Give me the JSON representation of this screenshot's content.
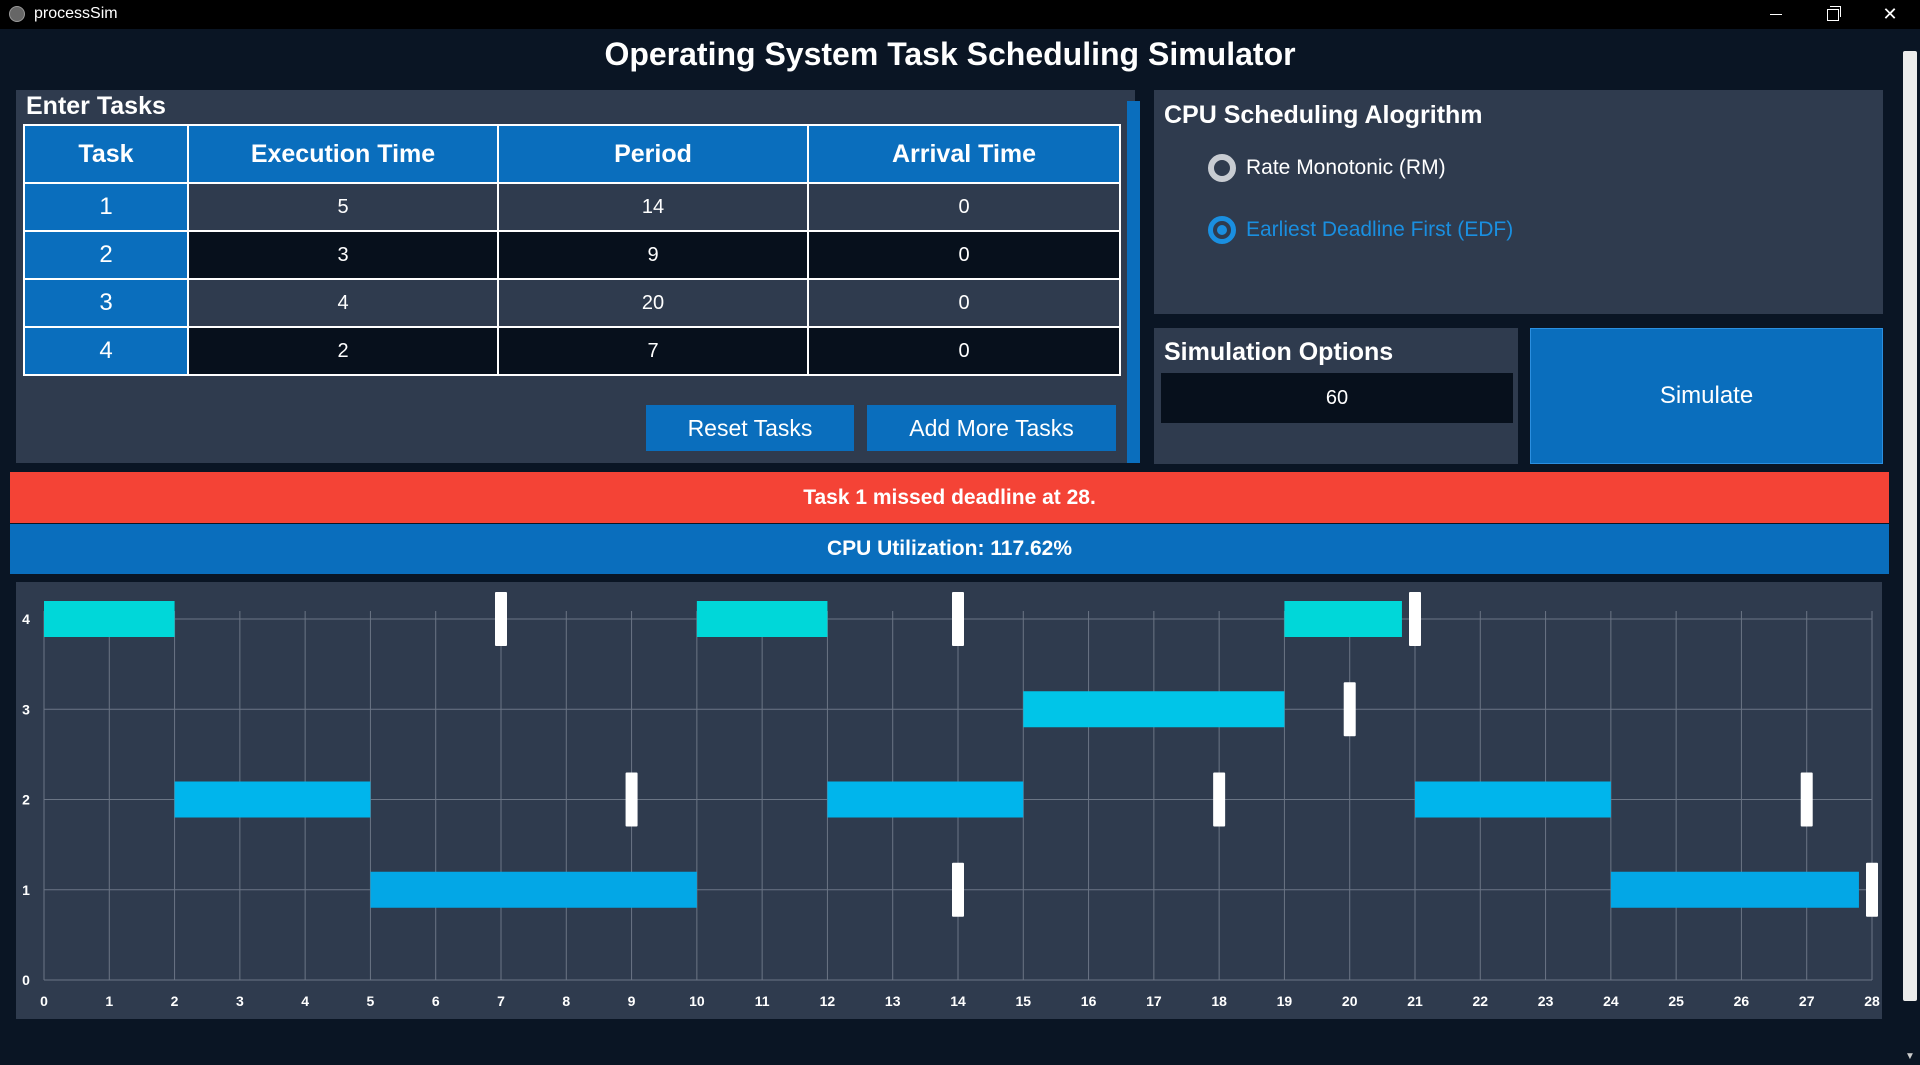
{
  "window": {
    "title": "processSim"
  },
  "app": {
    "title": "Operating System Task Scheduling Simulator"
  },
  "tasks_panel": {
    "heading": "Enter Tasks",
    "columns": [
      "Task",
      "Execution Time",
      "Period",
      "Arrival Time"
    ],
    "rows": [
      {
        "task": "1",
        "execution": "5",
        "period": "14",
        "arrival": "0"
      },
      {
        "task": "2",
        "execution": "3",
        "period": "9",
        "arrival": "0"
      },
      {
        "task": "3",
        "execution": "4",
        "period": "20",
        "arrival": "0"
      },
      {
        "task": "4",
        "execution": "2",
        "period": "7",
        "arrival": "0"
      }
    ],
    "reset_label": "Reset Tasks",
    "add_label": "Add More Tasks"
  },
  "algorithm_panel": {
    "heading": "CPU Scheduling Alogrithm",
    "options": [
      {
        "label": "Rate Monotonic (RM)",
        "selected": false
      },
      {
        "label": "Earliest Deadline First (EDF)",
        "selected": true
      }
    ]
  },
  "simulation_panel": {
    "heading": "Simulation Options",
    "duration_value": "60",
    "simulate_label": "Simulate"
  },
  "status": {
    "deadline_message": "Task 1 missed deadline at 28.",
    "utilization_message": "CPU Utilization: 117.62%"
  },
  "colors": {
    "accent": "#0a6ebd",
    "error": "#f44336",
    "panel": "#2f3b4e",
    "background": "#0a1524"
  },
  "chart_data": {
    "type": "gantt",
    "xlim": [
      0,
      28
    ],
    "ylim": [
      0,
      4
    ],
    "x_ticks": [
      0,
      1,
      2,
      3,
      4,
      5,
      6,
      7,
      8,
      9,
      10,
      11,
      12,
      13,
      14,
      15,
      16,
      17,
      18,
      19,
      20,
      21,
      22,
      23,
      24,
      25,
      26,
      27,
      28
    ],
    "y_ticks": [
      0,
      1,
      2,
      3,
      4
    ],
    "bars": [
      {
        "task": 4,
        "start": 0,
        "end": 2
      },
      {
        "task": 2,
        "start": 2,
        "end": 5
      },
      {
        "task": 1,
        "start": 5,
        "end": 10
      },
      {
        "task": 4,
        "start": 10,
        "end": 12
      },
      {
        "task": 2,
        "start": 12,
        "end": 15
      },
      {
        "task": 3,
        "start": 15,
        "end": 19
      },
      {
        "task": 4,
        "start": 19,
        "end": 20.8
      },
      {
        "task": 2,
        "start": 21,
        "end": 24
      },
      {
        "task": 1,
        "start": 24,
        "end": 27.8
      }
    ],
    "deadlines": [
      {
        "task": 4,
        "time": 7
      },
      {
        "task": 4,
        "time": 14
      },
      {
        "task": 4,
        "time": 21
      },
      {
        "task": 3,
        "time": 20
      },
      {
        "task": 2,
        "time": 9
      },
      {
        "task": 2,
        "time": 18
      },
      {
        "task": 2,
        "time": 27
      },
      {
        "task": 1,
        "time": 14
      },
      {
        "task": 1,
        "time": 28
      }
    ],
    "bar_colors": {
      "4": "#00d7d9",
      "3": "#00c5e8",
      "2": "#00b5ec",
      "1": "#03a7e6"
    },
    "grid": true
  }
}
